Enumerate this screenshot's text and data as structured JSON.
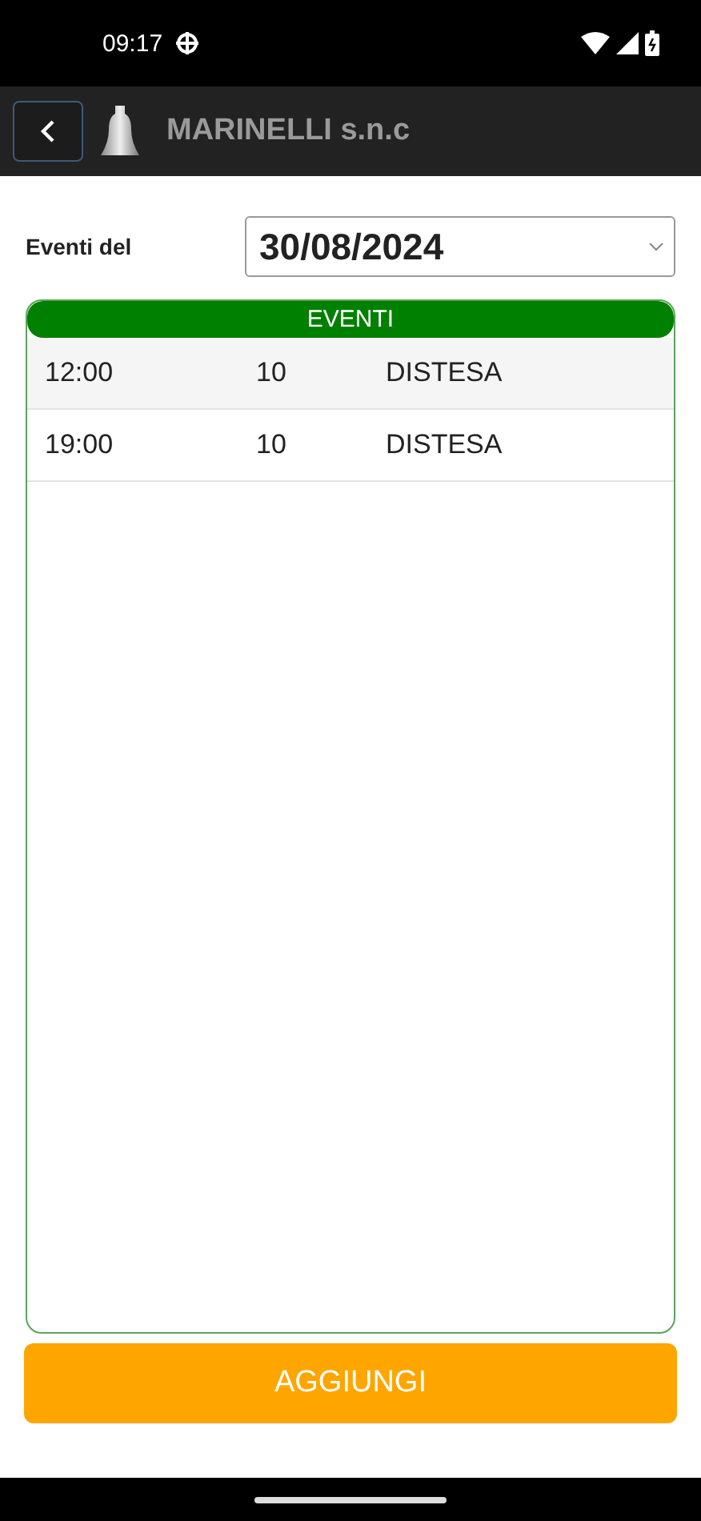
{
  "status_bar": {
    "time": "09:17"
  },
  "app_bar": {
    "title": "MARINELLI s.n.c"
  },
  "date_filter": {
    "label": "Eventi del",
    "value": "30/08/2024"
  },
  "events": {
    "title": "EVENTI",
    "rows": [
      {
        "time": "12:00",
        "count": "10",
        "type": "DISTESA"
      },
      {
        "time": "19:00",
        "count": "10",
        "type": "DISTESA"
      }
    ]
  },
  "add_button": {
    "label": "AGGIUNGI"
  }
}
